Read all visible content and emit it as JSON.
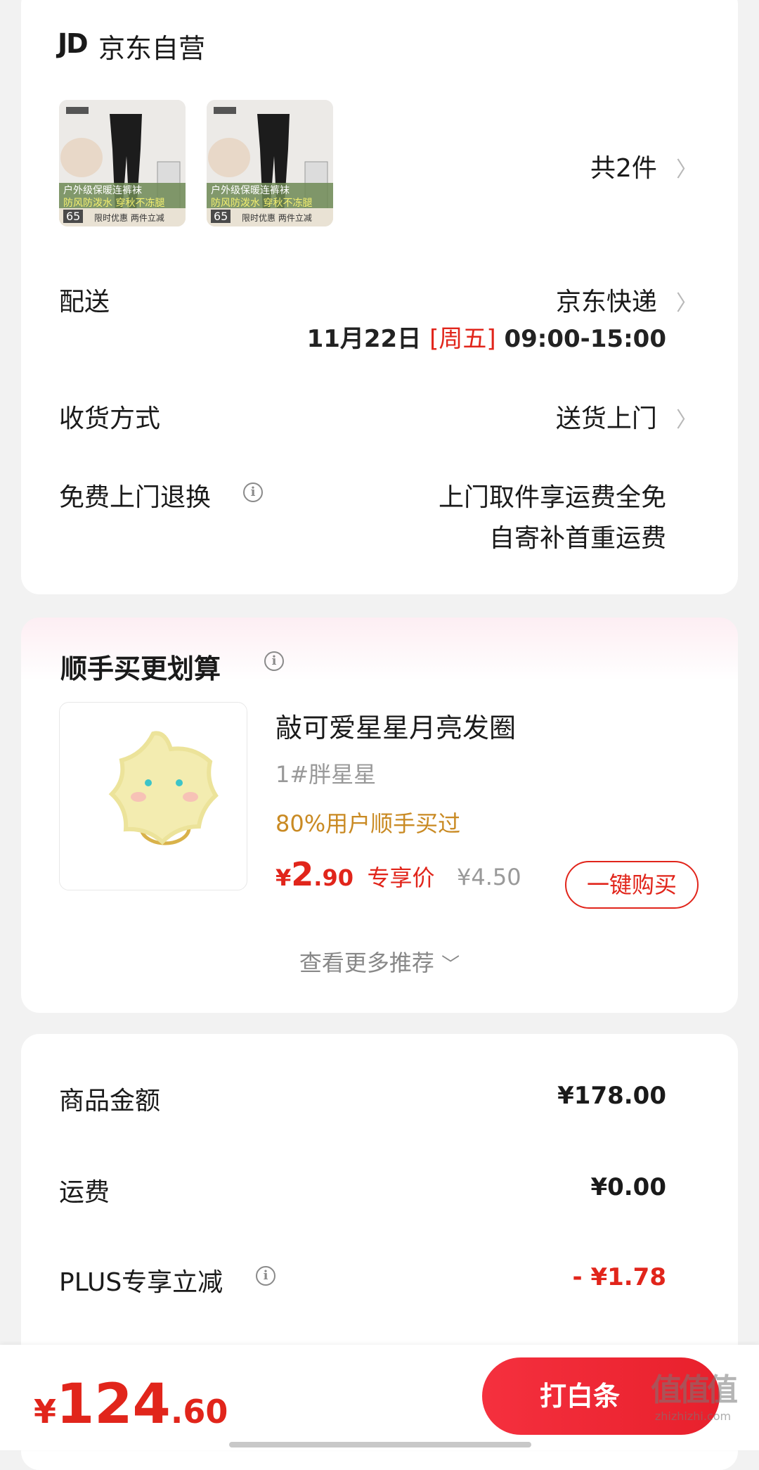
{
  "shop": {
    "logo": "JD",
    "name": "京东自营"
  },
  "products": {
    "count_label": "共2件",
    "thumbs": [
      {
        "line1": "户外级保暖连裤袜",
        "line2": "防风防泼水 穿秋不冻腿",
        "price": "65",
        "tag": "限时优惠 两件立减"
      },
      {
        "line1": "户外级保暖连裤袜",
        "line2": "防风防泼水 穿秋不冻腿",
        "price": "65",
        "tag": "限时优惠 两件立减"
      }
    ]
  },
  "delivery": {
    "label": "配送",
    "carrier": "京东快递",
    "date": "11月22日",
    "weekday": "[周五]",
    "time": "09:00-15:00"
  },
  "receive": {
    "label": "收货方式",
    "value": "送货上门"
  },
  "returns": {
    "label": "免费上门退换",
    "line1": "上门取件享运费全免",
    "line2": "自寄补首重运费"
  },
  "addon": {
    "title": "顺手买更划算",
    "product_name": "敲可爱星星月亮发圈",
    "variant": "1#胖星星",
    "social_proof": "80%用户顺手买过",
    "price_symbol": "¥",
    "price_int": "2",
    "price_dec": ".90",
    "price_tag": "专享价",
    "orig_price": "¥4.50",
    "buy_button": "一键购买",
    "more": "查看更多推荐"
  },
  "summary": {
    "rows": [
      {
        "label": "商品金额",
        "value": "¥178.00"
      },
      {
        "label": "运费",
        "value": "¥0.00"
      },
      {
        "label": "PLUS专享立减",
        "value": "- ¥1.78"
      }
    ]
  },
  "bottom": {
    "currency": "¥",
    "total_int": "124",
    "total_dec": ".60",
    "pay_button": "打白条",
    "watermark_main": "值值值",
    "watermark_sub": "zhizhizhi.com"
  },
  "colors": {
    "accent": "#e1251b",
    "gold": "#c98a23",
    "gray": "#8a8a8a",
    "background": "#f2f2f2"
  }
}
